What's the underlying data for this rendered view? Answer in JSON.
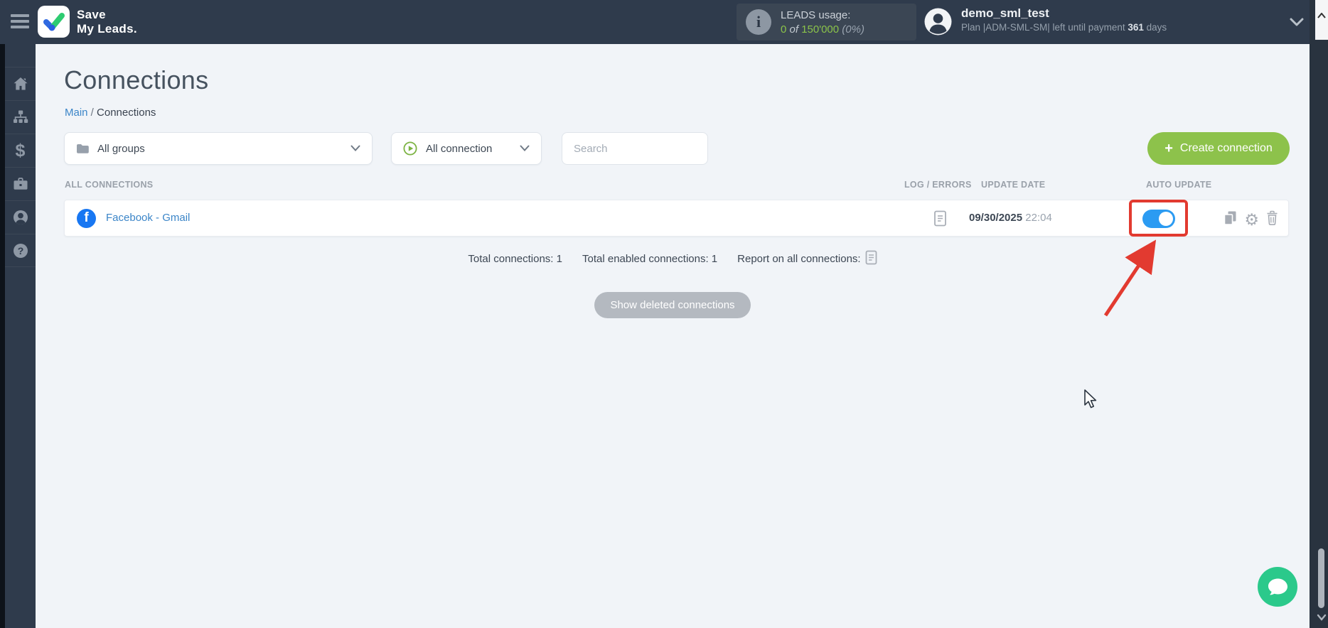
{
  "topbar": {
    "logo": {
      "line1": "Save",
      "line2": "My Leads."
    },
    "leads": {
      "label": "LEADS usage:",
      "used": "0",
      "of_word": " of ",
      "total": "150'000",
      "percent": " (0%)"
    },
    "user": {
      "name": "demo_sml_test",
      "plan_text": "Plan |ADM-SML-SM| left until payment ",
      "days": "361",
      "days_word": " days"
    }
  },
  "page": {
    "title": "Connections"
  },
  "breadcrumb": {
    "main": "Main",
    "sep": " / ",
    "current": "Connections"
  },
  "filters": {
    "groups_label": "All groups",
    "connection_label": "All connection",
    "search_placeholder": "Search"
  },
  "actions": {
    "create_label": "Create connection",
    "create_plus": "+",
    "show_deleted_label": "Show deleted connections"
  },
  "table": {
    "col_all": "ALL CONNECTIONS",
    "col_log": "LOG / ERRORS",
    "col_date": "UPDATE DATE",
    "col_auto": "AUTO UPDATE",
    "rows": [
      {
        "title": "Facebook - Gmail",
        "date": "09/30/2025",
        "time": "22:04",
        "auto_update": "on",
        "source_icon": "facebook"
      }
    ]
  },
  "summary": {
    "total": "Total connections: 1",
    "enabled": "Total enabled connections: 1",
    "report": "Report on all connections:"
  },
  "icons": {
    "sidebar": [
      "home-icon",
      "connections-icon",
      "billing-icon",
      "services-icon",
      "account-icon",
      "help-icon"
    ],
    "fb_letter": "f",
    "info_letter": "i",
    "dollar": "$",
    "gear_glyph": "⚙",
    "help_mark": "?"
  },
  "colors": {
    "topbar": "#2f3b4c",
    "accent_green": "#8dc24b",
    "usage_green": "#8bc34a",
    "link_blue": "#3b85c8",
    "toggle_blue": "#2b9bf2",
    "annotation_red": "#e23a30",
    "facebook_blue": "#1877f2",
    "chat_green": "#2bc98b"
  }
}
